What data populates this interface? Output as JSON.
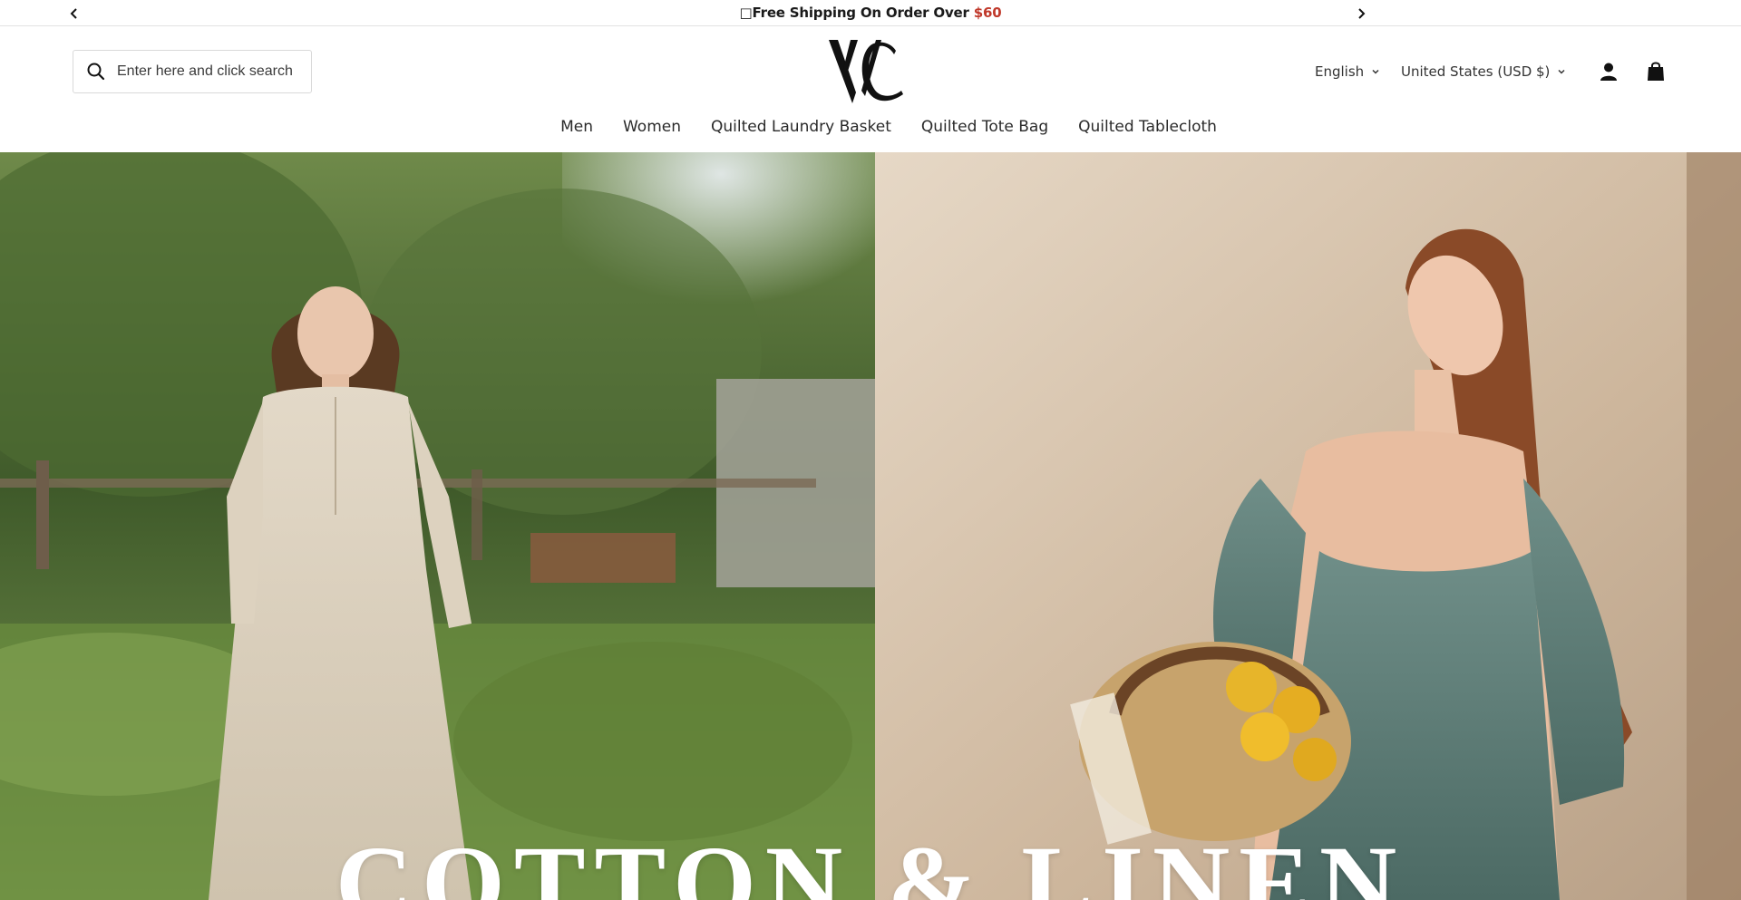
{
  "announcement": {
    "prefix_glyph": "□",
    "text": "Free Shipping On Order Over ",
    "amount": "$60",
    "amount_color": "#c0392b",
    "prev_icon": "chevron-left-icon",
    "next_icon": "chevron-right-icon"
  },
  "header": {
    "search": {
      "placeholder": "Enter here and click search",
      "icon": "search-icon"
    },
    "logo": {
      "text": "VC"
    },
    "language": {
      "label": "English",
      "icon": "chevron-down-icon"
    },
    "currency": {
      "label": "United States (USD $)",
      "icon": "chevron-down-icon"
    },
    "account_icon": "user-icon",
    "cart_icon": "shopping-bag-icon"
  },
  "nav": {
    "items": [
      {
        "label": "Men"
      },
      {
        "label": "Women"
      },
      {
        "label": "Quilted Laundry Basket"
      },
      {
        "label": "Quilted Tote Bag"
      },
      {
        "label": "Quilted Tablecloth"
      }
    ]
  },
  "hero": {
    "title": "COTTON & LINEN"
  }
}
